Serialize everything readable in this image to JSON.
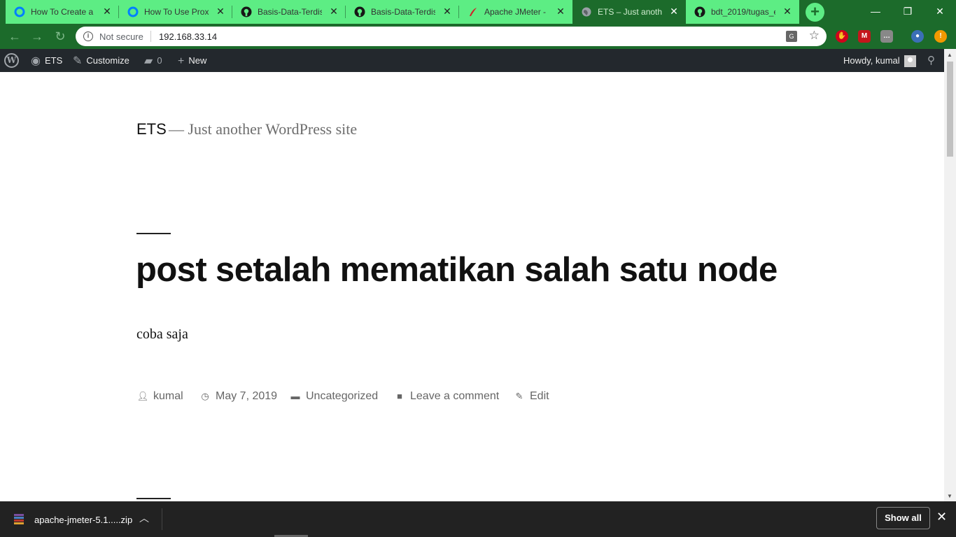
{
  "browser": {
    "tabs": [
      {
        "title": "How To Create a N",
        "icon": "digitalocean-icon",
        "active": false
      },
      {
        "title": "How To Use Proxy",
        "icon": "digitalocean-icon",
        "active": false
      },
      {
        "title": "Basis-Data-Terdist",
        "icon": "github-icon",
        "active": false
      },
      {
        "title": "Basis-Data-Terdist",
        "icon": "github-icon",
        "active": false
      },
      {
        "title": "Apache JMeter - D",
        "icon": "jmeter-feather-icon",
        "active": false
      },
      {
        "title": "ETS – Just another",
        "icon": "globe-icon",
        "active": true
      },
      {
        "title": "bdt_2019/tugas_et",
        "icon": "github-icon",
        "active": false
      }
    ],
    "address": {
      "security_label": "Not secure",
      "url": "192.168.33.14"
    }
  },
  "adminbar": {
    "site_name": "ETS",
    "customize": "Customize",
    "comments_count": "0",
    "new_label": "New",
    "greeting": "Howdy, kumal"
  },
  "site": {
    "title": "ETS",
    "separator": "—",
    "description": "Just another WordPress site"
  },
  "post": {
    "title": "post setalah mematikan salah satu node",
    "body": "coba saja",
    "meta": {
      "author": "kumal",
      "date": "May 7, 2019",
      "category": "Uncategorized",
      "comment_link": "Leave a comment",
      "edit_link": "Edit"
    }
  },
  "downloads": {
    "file_name": "apache-jmeter-5.1.....zip",
    "show_all": "Show all"
  },
  "colors": {
    "tab_bg": "#5ded84",
    "chrome_bg": "#1c6b2b",
    "adminbar_bg": "#23282d"
  }
}
